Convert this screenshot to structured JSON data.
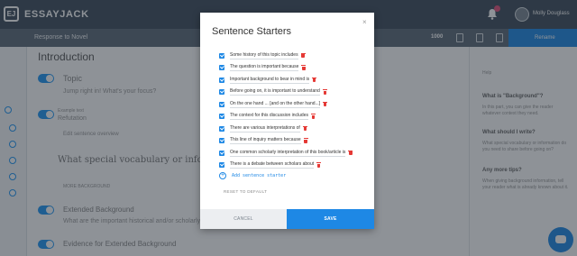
{
  "app": {
    "name": "ESSAYJACK",
    "user_name": "Molly Douglass"
  },
  "subbar": {
    "title": "Response to Novel",
    "word_count": "1000",
    "accent_label": "Rename"
  },
  "main": {
    "heading": "Introduction",
    "topic_label": "Topic",
    "topic_hint": "Jump right in! What's your focus?",
    "example_text": "Example text",
    "refutation_label": "Refutation",
    "edit_label": "Edit sentence overview",
    "prompt": "What special vocabulary or information",
    "more_bg": "MORE BACKGROUND",
    "extended_label": "Extended Background",
    "extended_hint": "What are the important historical and/or scholarly details",
    "evidence_label": "Evidence for Extended Background"
  },
  "right_panel": {
    "tab": "Help",
    "q1": "What is \"Background\"?",
    "a1": "In this part, you can give the reader whatever context they need.",
    "q2": "What should I write?",
    "a2": "What special vocabulary or information do you need to share before going on?",
    "q3": "Any more tips?",
    "a3": "When giving background information, tell your reader what is already known about it."
  },
  "modal": {
    "title": "Sentence Starters",
    "close": "×",
    "add_label": "Add sentence starter",
    "reset_label": "RESET TO DEFAULT",
    "cancel_label": "CANCEL",
    "save_label": "SAVE",
    "starters": [
      "Some history of this topic includes",
      "The question is important because",
      "Important background to bear in mind is",
      "Before going on, it is important to understand",
      "On the one hand ... [and on the other hand...]",
      "The context for this discussion includes",
      "There are various interpretations of",
      "This line of inquiry matters because",
      "One common scholarly interpretation of this book/article is",
      "There is a debate between scholars about"
    ]
  },
  "colors": {
    "accent": "#1e88e5",
    "topbar": "#3e4d5c",
    "delete": "#e53935"
  },
  "icons": [
    "logo-icon",
    "bell-icon",
    "close-icon",
    "checkbox-icon",
    "trash-icon",
    "add-icon",
    "chat-icon"
  ]
}
